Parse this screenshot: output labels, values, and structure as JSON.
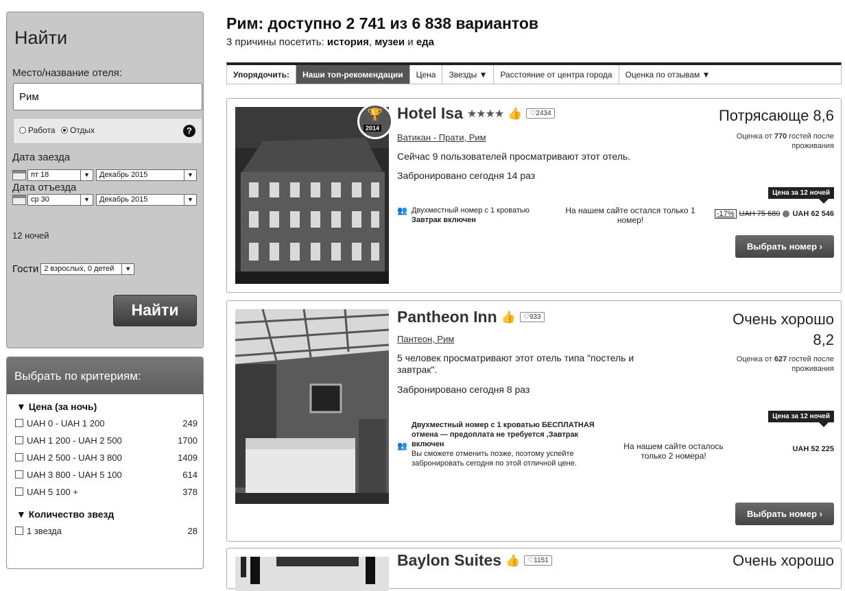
{
  "search": {
    "title": "Найти",
    "destination_label": "Место/название отеля:",
    "destination_value": "Рим",
    "purpose_work": "Работа",
    "purpose_leisure": "Отдых",
    "checkin_label": "Дата заезда",
    "checkin_day": "пт 18",
    "checkin_month": "Декабрь 2015",
    "checkout_label": "Дата отъезда",
    "checkout_day": "ср 30",
    "checkout_month": "Декабрь 2015",
    "nights": "12 ночей",
    "guests_label": "Гости",
    "guests_value": "2 взрослых, 0 детей",
    "button": "Найти"
  },
  "filters": {
    "title": "Выбрать по критериям:",
    "price_group": "▼ Цена (за ночь)",
    "price_ranges": [
      {
        "label": "UAH 0 - UAH 1 200",
        "count": "249"
      },
      {
        "label": "UAH 1 200 - UAH 2 500",
        "count": "1700"
      },
      {
        "label": "UAH 2 500 - UAH 3 800",
        "count": "1409"
      },
      {
        "label": "UAH 3 800 - UAH 5 100",
        "count": "614"
      },
      {
        "label": "UAH 5 100 +",
        "count": "378"
      }
    ],
    "stars_group": "▼ Количество звезд",
    "stars": [
      {
        "label": "1 звезда",
        "count": "28"
      }
    ]
  },
  "header": {
    "title": "Рим: доступно 2 741 из 6 838 вариантов",
    "subtitle_prefix": "3 причины посетить: ",
    "reason1": "история",
    "sep1": ", ",
    "reason2": "музеи",
    "sep2": " и ",
    "reason3": "еда"
  },
  "sort": {
    "label": "Упорядочить:",
    "options": [
      "Наши топ-рекомендации",
      "Цена",
      "Звезды ▼",
      "Расстояние от центра города",
      "Оценка по отзывам ▼"
    ]
  },
  "hotels": [
    {
      "name": "Hotel Isa",
      "stars": "★★★★",
      "likes": "2434",
      "location": "Ватикан - Прати, Рим",
      "viewers": "Сейчас 9 пользователей просматривают этот отель.",
      "booked": "Забронировано сегодня 14 раз",
      "room_line1": "Двухместный номер с 1 кроватью",
      "room_line2": "Завтрак включен",
      "availability": "На нашем сайте остался только 1 номер!",
      "rating_word": "Потрясающе 8,6",
      "rating_note_prefix": "Оценка от ",
      "rating_count": "770",
      "rating_note_suffix": " гостей после проживания",
      "price_tag": "Цена за 12 ночей",
      "discount": "-17%",
      "old_price": "UAH 75 680",
      "price": "UAH 62 546",
      "cta": "Выбрать номер ›",
      "award_year": "2014"
    },
    {
      "name": "Pantheon Inn",
      "likes": "933",
      "location": "Пантеон, Рим",
      "viewers": "5 человек просматривают этот отель типа \"постель и завтрак\".",
      "booked": "Забронировано сегодня 8 раз",
      "room_line1": "Двухместный номер с 1 кроватью БЕСПЛАТНАЯ отмена — предоплата не требуется ,Завтрак включен",
      "room_line2": "Вы сможете отменить позже, поэтому успейте забронировать сегодня по этой отличной цене.",
      "availability": "На нашем сайте осталось только 2 номера!",
      "rating_word_line1": "Очень хорошо",
      "rating_word_line2": "8,2",
      "rating_note_prefix": "Оценка от ",
      "rating_count": "627",
      "rating_note_suffix": " гостей после проживания",
      "price_tag": "Цена за 12 ночей",
      "price": "UAH 52 225",
      "cta": "Выбрать номер ›"
    },
    {
      "name": "Baylon Suites",
      "likes": "1151",
      "rating_word": "Очень хорошо"
    }
  ]
}
